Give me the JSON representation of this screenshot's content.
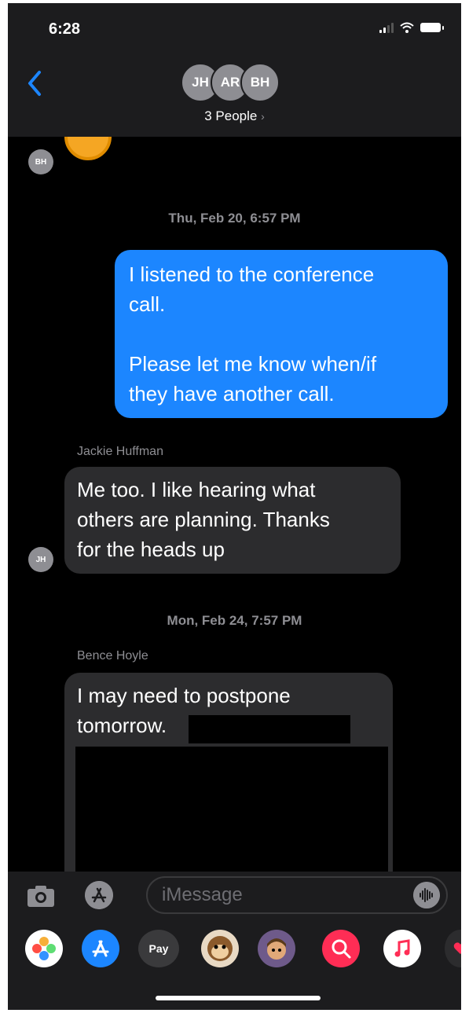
{
  "status": {
    "time": "6:28"
  },
  "header": {
    "avatars": [
      "JH",
      "AR",
      "BH"
    ],
    "title": "3 People"
  },
  "thread": {
    "top_avatar": "BH",
    "timestamp_1": "Thu, Feb 20, 6:57 PM",
    "outgoing_1": "I listened to the conference\ncall.\n\nPlease let me know when/if\nthey have another call.",
    "sender_1": "Jackie  Huffman",
    "incoming_1": "Me too. I like hearing what\nothers are planning. Thanks\nfor the heads up",
    "incoming_1_avatar": "JH",
    "timestamp_2": "Mon, Feb 24, 7:57 PM",
    "sender_2": "Bence  Hoyle",
    "incoming_2": "I may need to postpone\ntomorrow."
  },
  "input": {
    "placeholder": "iMessage"
  },
  "apps": [
    "photos-icon",
    "app-store-icon",
    "apple-pay-icon",
    "memoji-monkey-icon",
    "memoji-icon",
    "image-search-icon",
    "music-icon",
    "heart-app-icon"
  ],
  "apple_pay_label": "Pay"
}
